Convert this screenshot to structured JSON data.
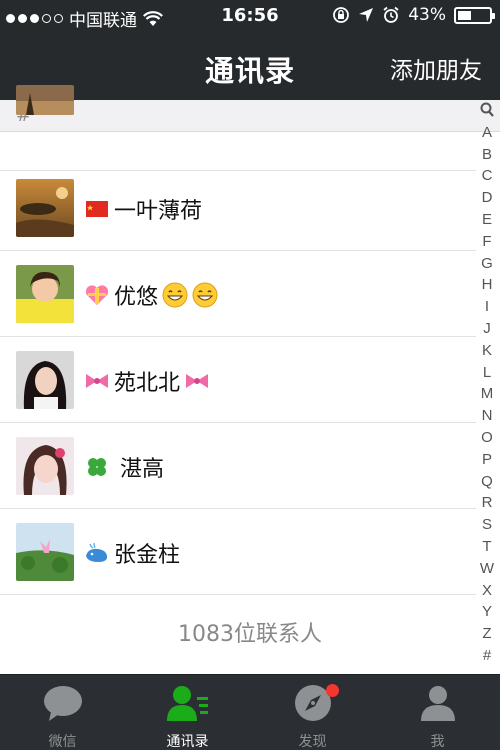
{
  "status_bar": {
    "carrier": "中国联通",
    "time": "16:56",
    "battery_percent": "43%",
    "battery_level": 0.43,
    "signal_bars_filled": 3,
    "signal_bars_total": 5
  },
  "nav": {
    "title": "通讯录",
    "action": "添加朋友"
  },
  "section": {
    "label": "#"
  },
  "contacts": [
    {
      "prefix_icon": "flag-emoji",
      "name": "一叶薄荷",
      "suffix_icons": []
    },
    {
      "prefix_icon": "gift-heart-emoji",
      "name": "优悠",
      "suffix_icons": [
        "grin-emoji",
        "grin-emoji"
      ]
    },
    {
      "prefix_icon": "ribbon-emoji",
      "name": "苑北北",
      "suffix_icons": [
        "ribbon-emoji"
      ]
    },
    {
      "prefix_icon": "clover-emoji",
      "name": "湛高",
      "suffix_icons": []
    },
    {
      "prefix_icon": "whale-emoji",
      "name": "张金柱",
      "suffix_icons": []
    }
  ],
  "footer": {
    "count_text": "1083位联系人"
  },
  "index": [
    "search-icon",
    "A",
    "B",
    "C",
    "D",
    "E",
    "F",
    "G",
    "H",
    "I",
    "J",
    "K",
    "L",
    "M",
    "N",
    "O",
    "P",
    "Q",
    "R",
    "S",
    "T",
    "W",
    "X",
    "Y",
    "Z",
    "#"
  ],
  "tabs": [
    {
      "label": "微信",
      "icon": "chat-bubble-icon",
      "active": false
    },
    {
      "label": "通讯录",
      "icon": "contacts-icon",
      "active": true
    },
    {
      "label": "发现",
      "icon": "compass-icon",
      "active": false,
      "badge": true
    },
    {
      "label": "我",
      "icon": "person-icon",
      "active": false
    }
  ],
  "colors": {
    "bar_dark": "#262a2d",
    "tab_active": "#1aad19",
    "tab_inactive": "#8e9194",
    "badge_red": "#f43530"
  }
}
